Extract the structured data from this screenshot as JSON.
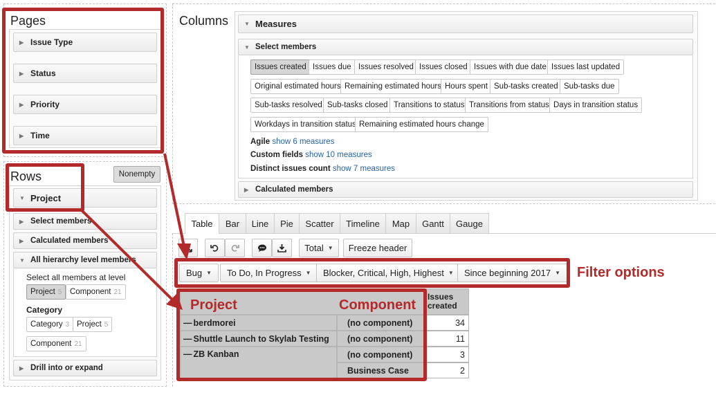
{
  "pages": {
    "title": "Pages",
    "items": [
      "Issue Type",
      "Status",
      "Priority",
      "Time"
    ]
  },
  "rows": {
    "title": "Rows",
    "nonempty_label": "Nonempty",
    "project_label": "Project",
    "select_members": "Select members",
    "calculated_members": "Calculated members",
    "all_hierarchy": "All hierarchy level members",
    "select_all_text": "Select all members at level",
    "level_chips": [
      {
        "label": "Project",
        "count": "5"
      },
      {
        "label": "Component",
        "count": "21"
      }
    ],
    "category_label": "Category",
    "category_chips": [
      {
        "label": "Category",
        "count": "3"
      },
      {
        "label": "Project",
        "count": "5"
      },
      {
        "label": "Component",
        "count": "21"
      }
    ],
    "drill_label": "Drill into or expand"
  },
  "columns": {
    "title": "Columns",
    "measures_label": "Measures",
    "select_members_label": "Select members",
    "chips_row1": [
      "Issues created",
      "Issues due",
      "Issues resolved",
      "Issues closed",
      "Issues with due date",
      "Issues last updated"
    ],
    "chips_row2": [
      "Original estimated hours",
      "Remaining estimated hours",
      "Hours spent",
      "Sub-tasks created",
      "Sub-tasks due"
    ],
    "chips_row3": [
      "Sub-tasks resolved",
      "Sub-tasks closed",
      "Transitions to status",
      "Transitions from status",
      "Days in transition status"
    ],
    "chips_row4": [
      "Workdays in transition status",
      "Remaining estimated hours change"
    ],
    "agile_label": "Agile",
    "agile_link": "show 6 measures",
    "custom_label": "Custom fields",
    "custom_link": "show 10 measures",
    "distinct_label": "Distinct issues count",
    "distinct_link": "show 7 measures",
    "calculated_label": "Calculated members"
  },
  "tabs": [
    "Table",
    "Bar",
    "Line",
    "Pie",
    "Scatter",
    "Timeline",
    "Map",
    "Gantt",
    "Gauge"
  ],
  "toolbar": {
    "total_label": "Total",
    "freeze_label": "Freeze header"
  },
  "filters": [
    "Bug",
    "To Do, In Progress",
    "Blocker, Critical, High, Highest",
    "Since beginning 2017"
  ],
  "annotations": {
    "filter_options": "Filter options",
    "project": "Project",
    "component": "Component"
  },
  "table": {
    "header_measure": "Issues created",
    "rows": [
      {
        "project": "berdmorei",
        "component": "(no component)",
        "value": "34"
      },
      {
        "project": "Shuttle Launch to Skylab Testing",
        "component": "(no component)",
        "value": "11"
      },
      {
        "project": "ZB Kanban",
        "component": "(no component)",
        "value": "3"
      },
      {
        "project": "",
        "component": "Business Case",
        "value": "2"
      }
    ]
  },
  "colors": {
    "annotation_red": "#b22a2a",
    "active_chip": "#d6d6d6",
    "link": "#2962a6"
  }
}
